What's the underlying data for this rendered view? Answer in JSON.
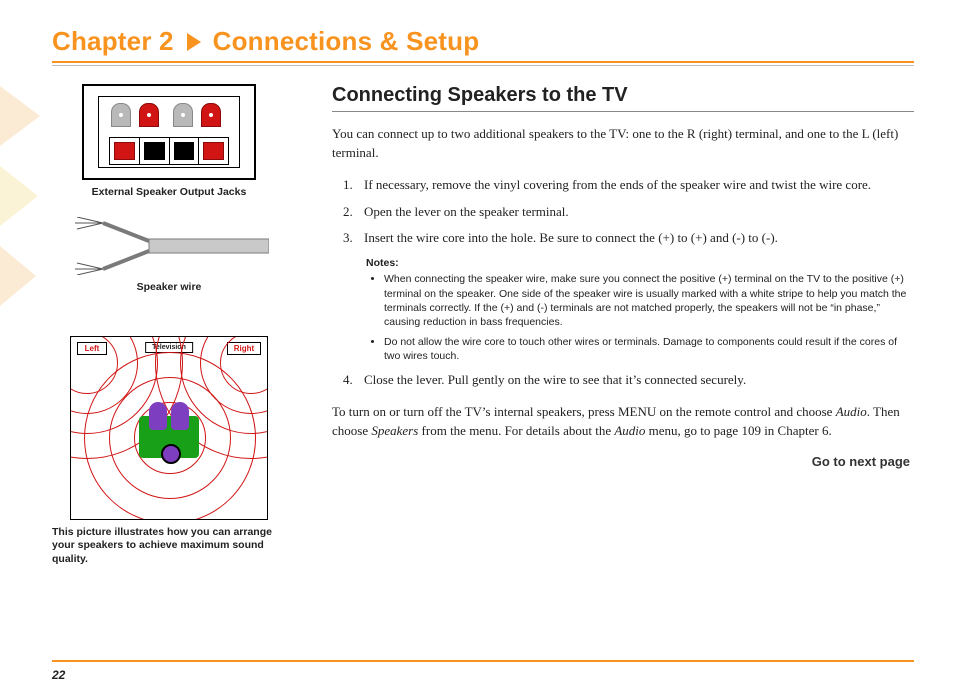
{
  "chapter": {
    "number_label": "Chapter 2",
    "title": "Connections & Setup"
  },
  "left": {
    "jacks_caption": "External Speaker Output Jacks",
    "wire_caption": "Speaker wire",
    "layout_caption": "This picture illustrates how you can arrange your speakers to achieve maximum sound quality.",
    "layout_labels": {
      "left": "Left",
      "right": "Right",
      "tv": "Television"
    }
  },
  "section": {
    "heading": "Connecting Speakers to the TV",
    "intro": "You can connect up to two additional speakers to the TV: one to the R (right) terminal, and one to the L (left) terminal.",
    "steps": [
      "If necessary, remove the vinyl covering from the ends of the speaker wire and twist the wire core.",
      "Open the lever on the speaker terminal.",
      "Insert the wire core into the hole. Be sure to connect the (+) to (+) and (-) to (-)."
    ],
    "notes_head": "Notes:",
    "notes": [
      "When connecting the speaker wire, make sure you connect the positive (+) terminal on the TV to the positive (+) terminal on the speaker. One side of the speaker wire is usually marked with a white stripe to help you match the terminals correctly. If the (+) and (-) terminals are not matched properly, the speakers will not be “in phase,” causing reduction in bass frequencies.",
      "Do not allow the wire core to touch other wires or terminals. Damage to components could result if the cores of two wires touch."
    ],
    "step4": "Close the lever. Pull gently on the wire to see that it’s connected securely.",
    "outro_1": "To turn on or turn off the TV’s internal speakers, press MENU on the remote control and choose ",
    "outro_audio1": "Audio",
    "outro_2": ". Then choose ",
    "outro_speakers": "Speakers",
    "outro_3": " from the menu. For details about the ",
    "outro_audio2": "Audio",
    "outro_4": " menu, go to page 109 in Chapter 6.",
    "goto": "Go to next page"
  },
  "page_number": "22"
}
